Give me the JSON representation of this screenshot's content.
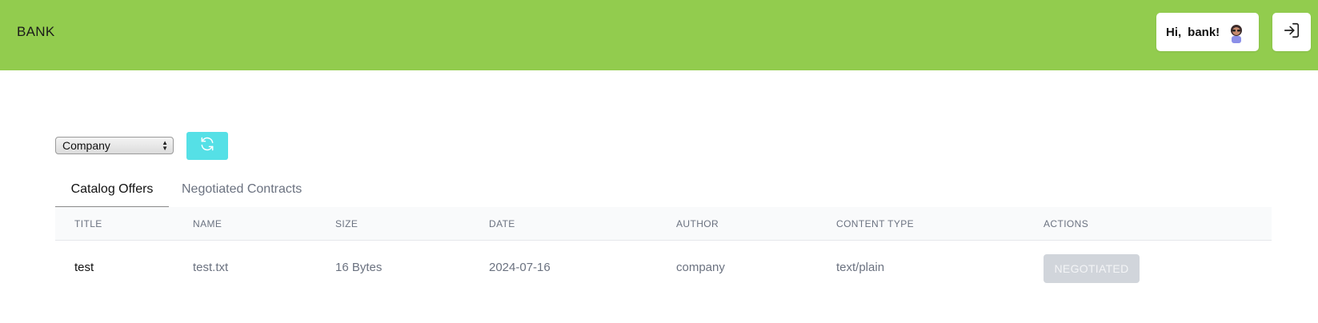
{
  "header": {
    "brand": "BANK",
    "greeting_hi": "Hi,",
    "username": "bank!",
    "avatar_icon": "user-avatar-icon",
    "logout_icon": "sign-in-icon",
    "bg_color": "#92cc4e"
  },
  "filter": {
    "selected": "Company",
    "refresh_icon": "refresh-icon",
    "refresh_color": "#55e0e6"
  },
  "tabs": [
    {
      "label": "Catalog Offers",
      "active": true
    },
    {
      "label": "Negotiated Contracts",
      "active": false
    }
  ],
  "table": {
    "columns": [
      "TITLE",
      "NAME",
      "SIZE",
      "DATE",
      "AUTHOR",
      "CONTENT TYPE",
      "ACTIONS"
    ],
    "rows": [
      {
        "title": "test",
        "name": "test.txt",
        "size": "16 Bytes",
        "date": "2024-07-16",
        "author": "company",
        "content_type": "text/plain",
        "action": "NEGOTIATED"
      }
    ]
  }
}
